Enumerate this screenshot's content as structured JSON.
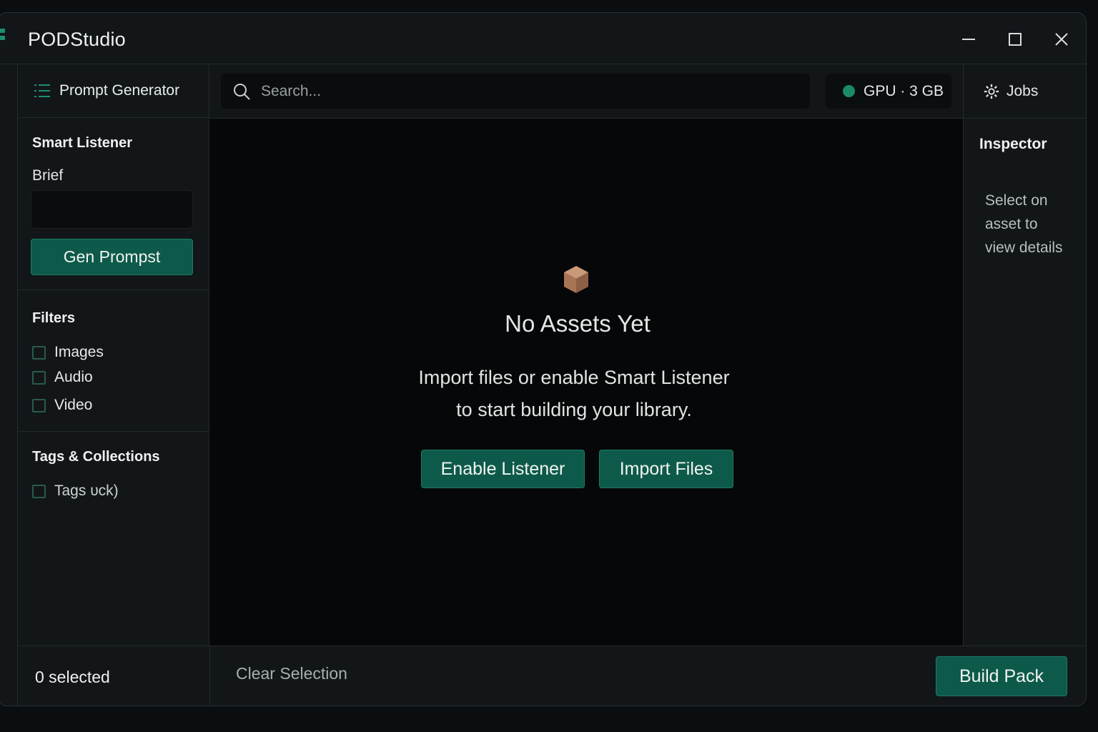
{
  "app": {
    "title": "PODStudio"
  },
  "sidebar": {
    "header_label": "Prompt Generator",
    "smart_listener": {
      "title": "Smart Listener",
      "brief_label": "Brief",
      "brief_value": "",
      "button_label": "Gen Prompst"
    },
    "filters": {
      "title": "Filters",
      "items": [
        {
          "label": "Images",
          "checked": false
        },
        {
          "label": "Audio",
          "checked": false
        },
        {
          "label": "Video",
          "checked": false
        }
      ]
    },
    "tags": {
      "title": "Tags & Collections",
      "items": [
        {
          "label": "Tags ᴜck)",
          "checked": false
        }
      ]
    }
  },
  "search": {
    "placeholder": "Search..."
  },
  "gpu": {
    "label": "GPU · 3 GB",
    "status_color": "#1a8a68"
  },
  "jobs": {
    "label": "Jobs",
    "icon": "gear-icon"
  },
  "main": {
    "empty_icon": "box-icon",
    "empty_title": "No Assets Yet",
    "empty_desc_line1": "Import files or enable Smart Listener",
    "empty_desc_line2": "to start building your library.",
    "enable_button": "Enable Listener",
    "import_button": "Import Files"
  },
  "inspector": {
    "title": "Inspector",
    "placeholder_line1": "Select on",
    "placeholder_line2": "asset to",
    "placeholder_line3": "view details"
  },
  "footer": {
    "selected_count": "0 selected",
    "clear_label": "Clear Selection",
    "build_label": "Build Pack"
  },
  "colors": {
    "accent": "#0e5a4a",
    "accent_border": "#1c7a63",
    "background": "#121619",
    "canvas": "#060708"
  }
}
